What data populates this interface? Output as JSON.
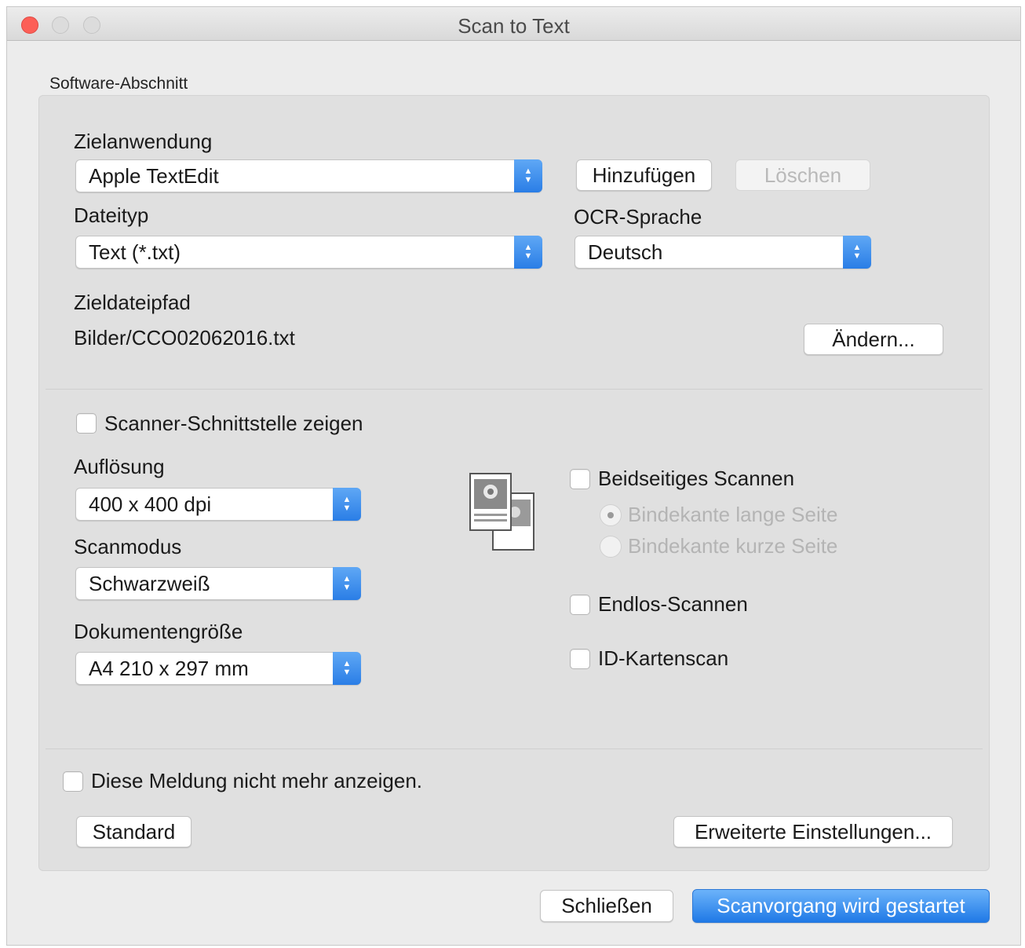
{
  "window": {
    "title": "Scan to Text"
  },
  "software_section": {
    "group_label": "Software-Abschnitt",
    "target_app_label": "Zielanwendung",
    "target_app_value": "Apple TextEdit",
    "add_button": "Hinzufügen",
    "delete_button": "Löschen",
    "file_type_label": "Dateityp",
    "file_type_value": "Text (*.txt)",
    "ocr_label": "OCR-Sprache",
    "ocr_value": "Deutsch",
    "target_path_label": "Zieldateipfad",
    "target_path_value": "Bilder/CCO02062016.txt",
    "change_button": "Ändern..."
  },
  "scan_settings": {
    "show_scanner_ui": {
      "label": "Scanner-Schnittstelle zeigen",
      "checked": false
    },
    "resolution_label": "Auflösung",
    "resolution_value": "400 x 400 dpi",
    "scan_mode_label": "Scanmodus",
    "scan_mode_value": "Schwarzweiß",
    "doc_size_label": "Dokumentengröße",
    "doc_size_value": "A4 210 x 297 mm",
    "duplex": {
      "label": "Beidseitiges Scannen",
      "checked": false
    },
    "binding_long": {
      "label": "Bindekante lange Seite",
      "selected": true,
      "enabled": false
    },
    "binding_short": {
      "label": "Bindekante kurze Seite",
      "selected": false,
      "enabled": false
    },
    "continuous": {
      "label": "Endlos-Scannen",
      "checked": false
    },
    "id_card": {
      "label": "ID-Kartenscan",
      "checked": false
    }
  },
  "footer": {
    "dont_show": {
      "label": "Diese Meldung nicht mehr anzeigen.",
      "checked": false
    },
    "default_button": "Standard",
    "advanced_button": "Erweiterte Einstellungen...",
    "close_button": "Schließen",
    "start_button": "Scanvorgang wird gestartet"
  },
  "colors": {
    "accent": "#2a7ee6",
    "close_traffic": "#fc5f57",
    "panel_bg": "#e0e0e0",
    "window_bg": "#ececec"
  }
}
